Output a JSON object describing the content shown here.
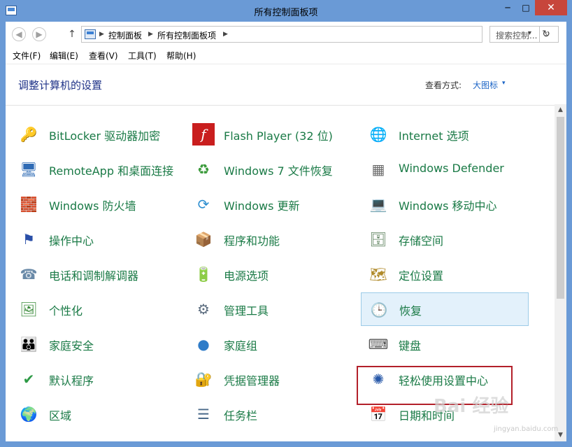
{
  "window": {
    "title": "所有控制面板项",
    "minimize": "─",
    "maximize": "□",
    "close": "✕"
  },
  "address": {
    "back": "◀",
    "forward": "▶",
    "up": "↑",
    "crumbs": [
      "控制面板",
      "所有控制面板项"
    ],
    "sep": "▶",
    "dropdown": "▾",
    "refresh": "↻",
    "search_placeholder": "搜索控制...",
    "search_icon": "⌕"
  },
  "menus": [
    "文件(F)",
    "编辑(E)",
    "查看(V)",
    "工具(T)",
    "帮助(H)"
  ],
  "header": {
    "title": "调整计算机的设置",
    "view_label": "查看方式:",
    "view_value": "大图标",
    "view_caret": "▾"
  },
  "items": [
    {
      "label": "BitLocker 驱动器加密",
      "icon": "🔑",
      "icon_name": "bitlocker-icon"
    },
    {
      "label": "Flash Player (32 位)",
      "icon": "f",
      "icon_name": "flash-player-icon"
    },
    {
      "label": "Internet 选项",
      "icon": "🌐",
      "icon_name": "internet-options-icon"
    },
    {
      "label": "RemoteApp 和桌面连接",
      "icon": "🖥",
      "icon_name": "remoteapp-icon"
    },
    {
      "label": "Windows 7 文件恢复",
      "icon": "♻",
      "icon_name": "windows7-file-recovery-icon"
    },
    {
      "label": "Windows Defender",
      "icon": "▦",
      "icon_name": "windows-defender-icon"
    },
    {
      "label": "Windows 防火墙",
      "icon": "🧱",
      "icon_name": "windows-firewall-icon"
    },
    {
      "label": "Windows 更新",
      "icon": "⟳",
      "icon_name": "windows-update-icon"
    },
    {
      "label": "Windows 移动中心",
      "icon": "💻",
      "icon_name": "windows-mobility-center-icon"
    },
    {
      "label": "操作中心",
      "icon": "⚑",
      "icon_name": "action-center-icon"
    },
    {
      "label": "程序和功能",
      "icon": "📦",
      "icon_name": "programs-features-icon"
    },
    {
      "label": "存储空间",
      "icon": "🗄",
      "icon_name": "storage-spaces-icon"
    },
    {
      "label": "电话和调制解调器",
      "icon": "☎",
      "icon_name": "phone-modem-icon"
    },
    {
      "label": "电源选项",
      "icon": "🔋",
      "icon_name": "power-options-icon"
    },
    {
      "label": "定位设置",
      "icon": "🗺",
      "icon_name": "location-settings-icon"
    },
    {
      "label": "个性化",
      "icon": "🖼",
      "icon_name": "personalization-icon"
    },
    {
      "label": "管理工具",
      "icon": "⚙",
      "icon_name": "admin-tools-icon"
    },
    {
      "label": "恢复",
      "icon": "🕒",
      "icon_name": "recovery-icon"
    },
    {
      "label": "家庭安全",
      "icon": "👪",
      "icon_name": "family-safety-icon"
    },
    {
      "label": "家庭组",
      "icon": "●",
      "icon_name": "homegroup-icon"
    },
    {
      "label": "键盘",
      "icon": "⌨",
      "icon_name": "keyboard-icon"
    },
    {
      "label": "默认程序",
      "icon": "✔",
      "icon_name": "default-programs-icon"
    },
    {
      "label": "凭据管理器",
      "icon": "🔐",
      "icon_name": "credential-manager-icon"
    },
    {
      "label": "轻松使用设置中心",
      "icon": "✺",
      "icon_name": "ease-of-access-icon"
    },
    {
      "label": "区域",
      "icon": "🌍",
      "icon_name": "region-icon"
    },
    {
      "label": "任务栏",
      "icon": "☰",
      "icon_name": "taskbar-icon"
    },
    {
      "label": "日期和时间",
      "icon": "📅",
      "icon_name": "date-time-icon"
    }
  ],
  "scroll": {
    "up": "▲",
    "down": "▼"
  },
  "watermark": {
    "text": "Bai 经验",
    "sub": "jingyan.baidu.com"
  },
  "colors": {
    "label": "#1a7a46",
    "title": "#1e3287",
    "link": "#1a64c6",
    "highlight": "#b3202a",
    "selected_bg": "#e3f1fb"
  }
}
